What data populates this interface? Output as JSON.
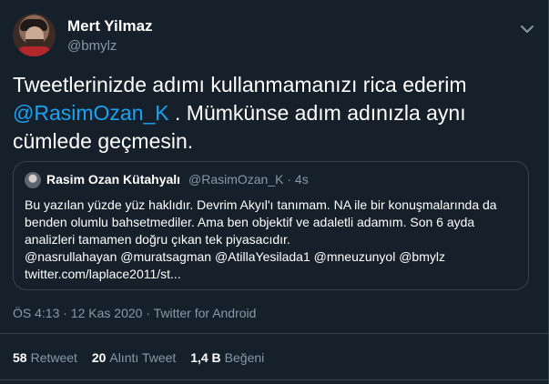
{
  "author": {
    "name": "Mert Yilmaz",
    "handle": "@bmylz"
  },
  "tweet": {
    "text_before": "Tweetlerinizde adımı kullanmamanızı rica ederim ",
    "mention": "@RasimOzan_K",
    "text_after": " . Mümkünse adım adınızla aynı cümlede geçmesin."
  },
  "quoted_tweet": {
    "name": "Rasim Ozan Kütahyalı",
    "handle_time": "@RasimOzan_K · 4s",
    "body": "Bu yazılan yüzde yüz haklıdır. Devrim Akyıl'ı tanımam. NA ile bir konuşmalarında da benden olumlu bahsetmediler. Ama ben objektif ve adaletli adamım. Son 6 ayda analizleri tamamen doğru çıkan tek piyasacıdır.\n@nasrullahayan @muratsagman @AtillaYesilada1 @mneuzunyol @bmylz\ntwitter.com/laplace2011/st..."
  },
  "meta": "ÖS 4:13 · 12 Kas 2020 · Twitter for Android",
  "stats": {
    "retweets_count": "58",
    "retweets_label": "Retweet",
    "quotes_count": "20",
    "quotes_label": "Alıntı Tweet",
    "likes_count": "1,4 B",
    "likes_label": "Beğeni"
  },
  "colors": {
    "background": "#15202b",
    "accent": "#1da1f2",
    "secondary_text": "#8899a6",
    "border": "#38444d"
  },
  "icons": {
    "more": "more-icon"
  }
}
